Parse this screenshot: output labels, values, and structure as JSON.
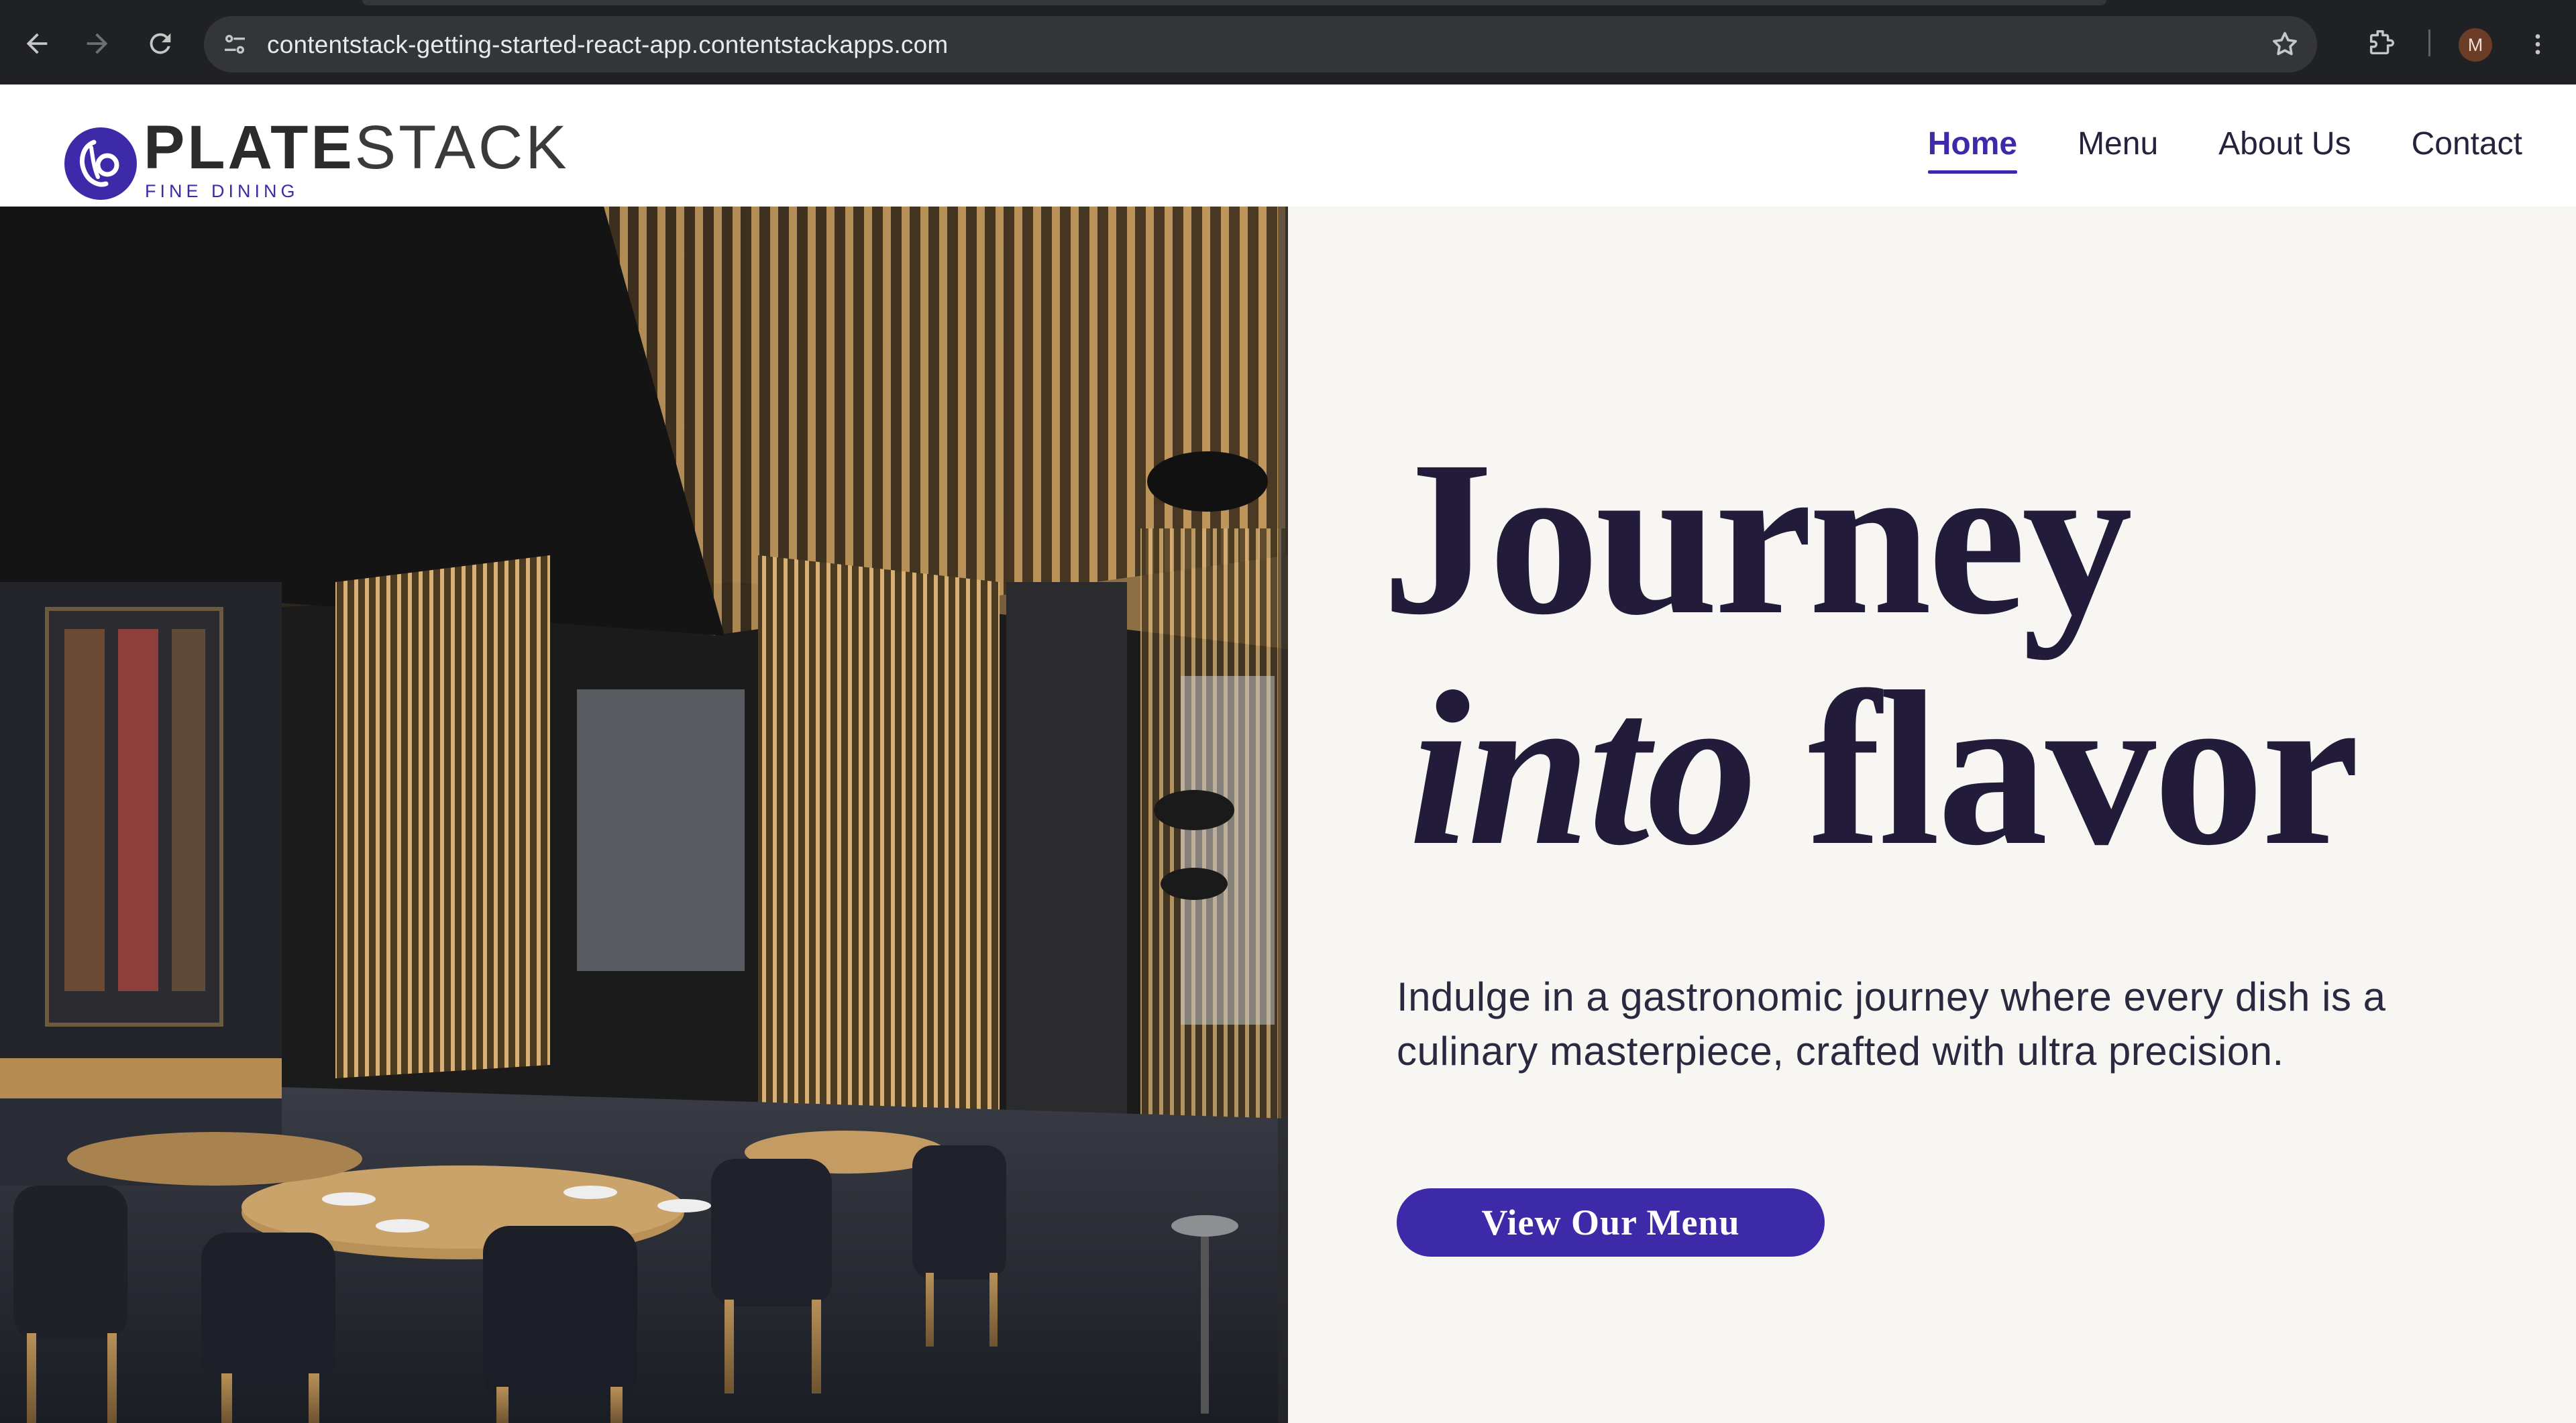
{
  "browser": {
    "url": "contentstack-getting-started-react-app.contentstackapps.com",
    "profile_initial": "M",
    "icons": [
      "back-arrow-icon",
      "forward-arrow-icon",
      "reload-icon",
      "site-info-icon",
      "bookmark-star-icon",
      "extensions-icon",
      "more-menu-icon"
    ]
  },
  "site": {
    "logo": {
      "word_bold": "PLATE",
      "word_light": "STACK",
      "subtitle": "FINE DINING"
    },
    "nav": [
      {
        "label": "Home",
        "active": true
      },
      {
        "label": "Menu",
        "active": false
      },
      {
        "label": "About Us",
        "active": false
      },
      {
        "label": "Contact",
        "active": false
      }
    ]
  },
  "hero": {
    "headline_line1": "Journey",
    "headline_italic": "into",
    "headline_rest": " flavor",
    "tagline": "Indulge in a gastronomic journey where every dish is a culinary masterpiece, crafted with ultra precision.",
    "cta_label": "View Our Menu",
    "image": "restaurant-interior-photo"
  },
  "colors": {
    "brand": "#3d2aa8",
    "text_dark": "#221c3a",
    "hero_bg": "#f7f6f3",
    "chrome_bg": "#202124"
  }
}
